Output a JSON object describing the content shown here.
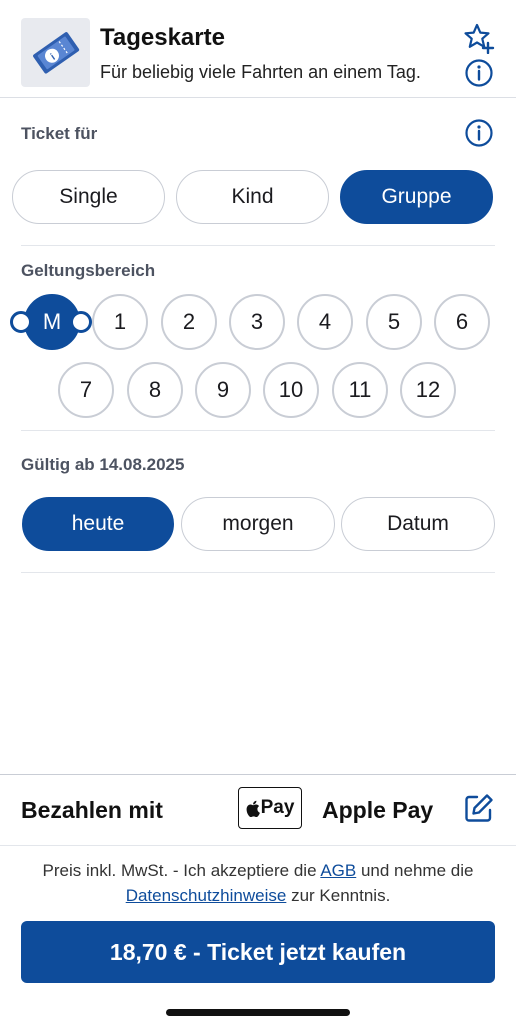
{
  "header": {
    "title": "Tageskarte",
    "subtitle": "Für beliebig viele Fahrten an einem Tag.",
    "icons": [
      "ticket-icon",
      "favorite-add-icon",
      "info-icon"
    ]
  },
  "ticket_for": {
    "label": "Ticket für",
    "options": [
      {
        "label": "Single",
        "selected": false
      },
      {
        "label": "Kind",
        "selected": false
      },
      {
        "label": "Gruppe",
        "selected": true
      }
    ]
  },
  "zones": {
    "label": "Geltungsbereich",
    "row1": [
      "M",
      "1",
      "2",
      "3",
      "4",
      "5",
      "6"
    ],
    "row2": [
      "7",
      "8",
      "9",
      "10",
      "11",
      "12"
    ],
    "selected": "M"
  },
  "valid_from": {
    "label": "Gültig ab 14.08.2025",
    "options": [
      {
        "label": "heute",
        "selected": true
      },
      {
        "label": "morgen",
        "selected": false
      },
      {
        "label": "Datum",
        "selected": false
      }
    ]
  },
  "payment": {
    "label": "Bezahlen mit",
    "badge": "Pay",
    "method": "Apple Pay"
  },
  "legal": {
    "part1": "Preis inkl. MwSt. - Ich akzeptiere die ",
    "agb": "AGB",
    "part2": " und nehme die ",
    "privacy": "Datenschutzhinweise",
    "part3": " zur Kenntnis."
  },
  "buy_button": "18,70 € - Ticket jetzt kaufen",
  "colors": {
    "accent": "#0e4c9b",
    "border": "#c9cdd5",
    "label": "#4d5361"
  }
}
